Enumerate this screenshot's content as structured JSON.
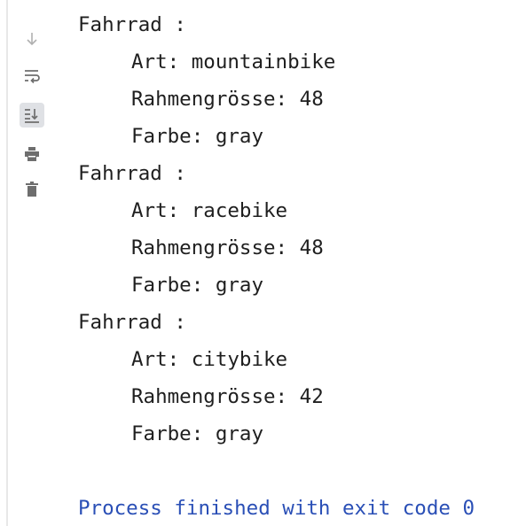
{
  "toolbar": {
    "icons": [
      "scroll-down-arrow-icon",
      "soft-wrap-icon",
      "scroll-to-end-icon",
      "print-icon",
      "trash-icon"
    ]
  },
  "output": {
    "blocks": [
      {
        "header": "Fahrrad :",
        "art": "Art: mountainbike",
        "rahmen": "Rahmengrösse: 48",
        "farbe": "Farbe: gray"
      },
      {
        "header": "Fahrrad :",
        "art": "Art: racebike",
        "rahmen": "Rahmengrösse: 48",
        "farbe": "Farbe: gray"
      },
      {
        "header": "Fahrrad :",
        "art": "Art: citybike",
        "rahmen": "Rahmengrösse: 42",
        "farbe": "Farbe: gray"
      }
    ],
    "finished": "Process finished with exit code 0"
  },
  "colors": {
    "text": "#1f1f1f",
    "process": "#2a4fb6",
    "icon": "#6e6e6e",
    "active_bg": "#dfe1e5"
  }
}
